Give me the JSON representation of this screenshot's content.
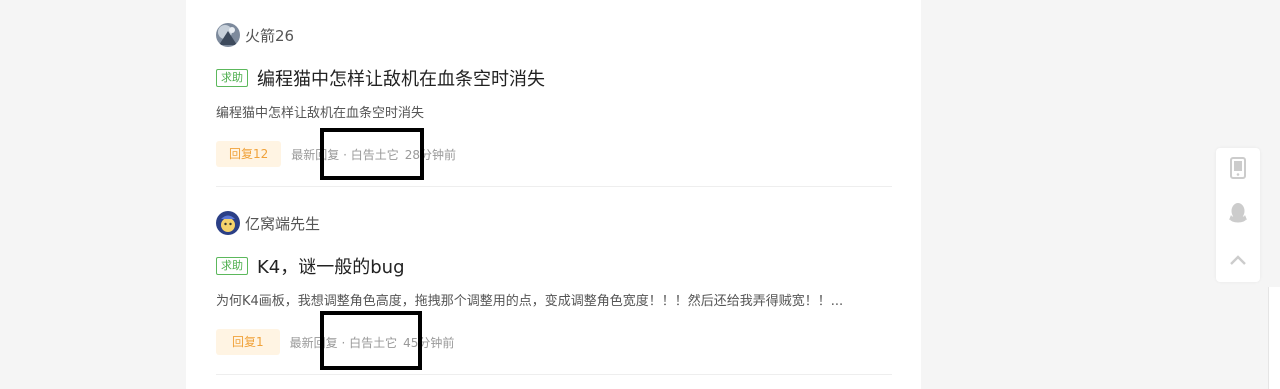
{
  "posts": [
    {
      "author": "火箭26",
      "tag": "求助",
      "title": "编程猫中怎样让敌机在血条空时消失",
      "excerpt": "编程猫中怎样让敌机在血条空时消失",
      "reply_count": "回复12",
      "latest_prefix": "最新回复 · ",
      "latest_user": "白告土它",
      "time": "28分钟前",
      "avatar_icon": "rocket-avatar"
    },
    {
      "author": "亿窝端先生",
      "tag": "求助",
      "title": "K4，谜一般的bug",
      "excerpt": "为何K4画板，我想调整角色高度，拖拽那个调整用的点，变成调整角色宽度！！！然后还给我弄得贼宽！！...",
      "reply_count": "回复1",
      "latest_prefix": "最新回复 · ",
      "latest_user": "白告土它",
      "time": "45分钟前",
      "avatar_icon": "cartoon-avatar"
    }
  ],
  "float_bar": {
    "icons": [
      "mobile-icon",
      "qq-icon",
      "back-to-top-icon"
    ]
  },
  "colors": {
    "tag_green": "#5cb85c",
    "reply_orange": "#f0a23a",
    "reply_bg": "#fff4e3",
    "page_bg": "#f5f5f5"
  }
}
